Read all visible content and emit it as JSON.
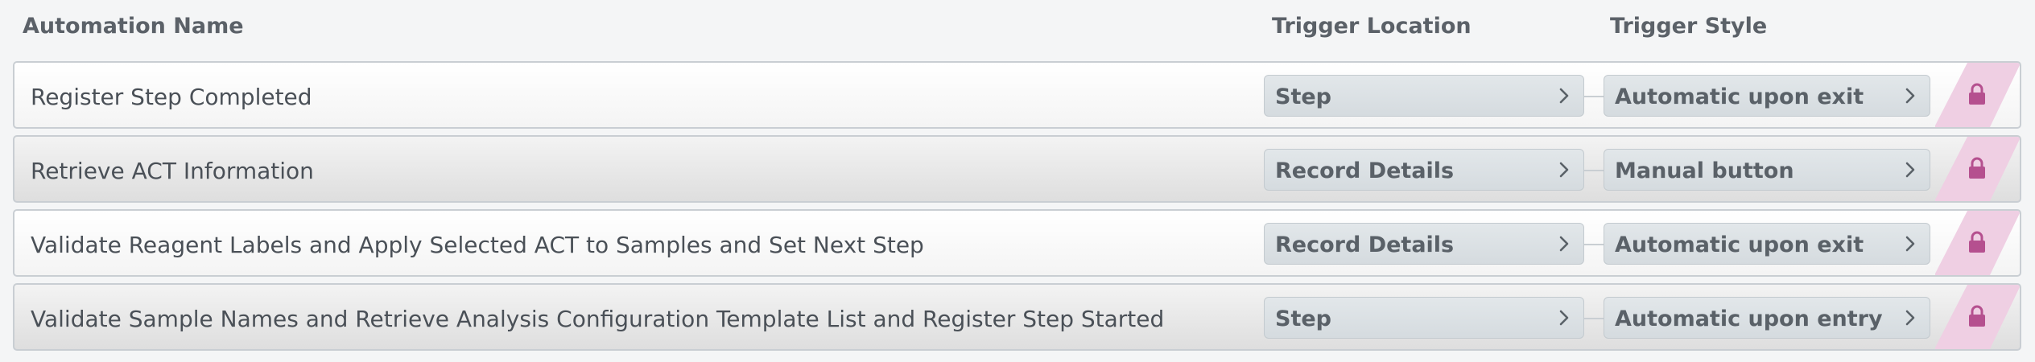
{
  "colors": {
    "lock": "#b5508f",
    "stripe": "#efcfe3",
    "pill_text": "#5a6168",
    "header_text": "#5b6168"
  },
  "header": {
    "name": "Automation Name",
    "location": "Trigger Location",
    "style": "Trigger Style"
  },
  "rows": [
    {
      "name": "Register Step Completed",
      "location": "Step",
      "style": "Automatic upon exit",
      "lock_icon": "lock-icon"
    },
    {
      "name": "Retrieve ACT Information",
      "location": "Record Details",
      "style": "Manual button",
      "lock_icon": "lock-icon"
    },
    {
      "name": "Validate Reagent Labels and Apply Selected ACT to Samples and Set Next Step",
      "location": "Record Details",
      "style": "Automatic upon exit",
      "lock_icon": "lock-icon"
    },
    {
      "name": "Validate Sample Names and Retrieve Analysis Configuration Template List and Register Step Started",
      "location": "Step",
      "style": "Automatic upon entry",
      "lock_icon": "lock-icon"
    }
  ]
}
